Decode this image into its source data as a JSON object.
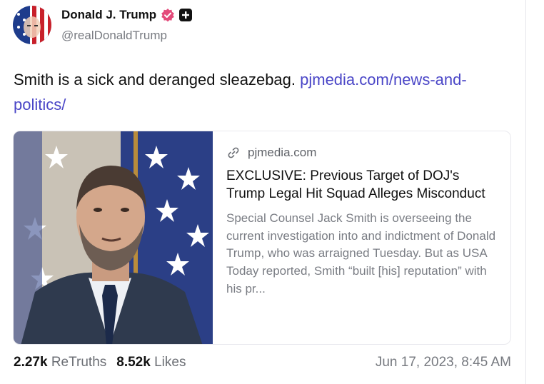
{
  "post": {
    "author": {
      "display_name": "Donald J. Trump",
      "handle": "@realDonaldTrump",
      "verified_icon": "verified-badge-icon",
      "plus_icon": "plus-badge-icon"
    },
    "text": "Smith is a sick and deranged sleazebag. ",
    "link_text": "pjmedia.com/news-and-politics/",
    "link_card": {
      "domain": "pjmedia.com",
      "title": "EXCLUSIVE: Previous Target of DOJ's Trump Legal Hit Squad Alleges Misconduct",
      "description": "Special Counsel Jack Smith is overseeing the current investigation into and indictment of Donald Trump, who was arraigned Tuesday. But as USA Today reported, Smith “built [his] reputation” with his pr..."
    },
    "stats": {
      "retruths_count": "2.27k",
      "retruths_label": "ReTruths",
      "likes_count": "8.52k",
      "likes_label": "Likes"
    },
    "timestamp": "Jun 17, 2023, 8:45 AM"
  },
  "colors": {
    "link": "#4a46c7",
    "verified": "#e34a7a",
    "muted": "#777a80"
  }
}
